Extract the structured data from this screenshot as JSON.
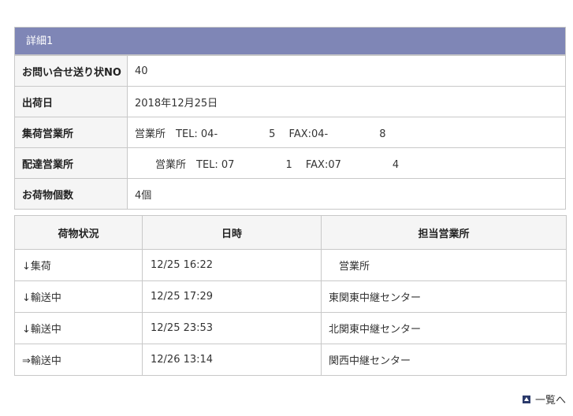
{
  "detail": {
    "header": "詳細1",
    "rows": [
      {
        "label": "お問い合せ送り状NO",
        "value": "40"
      },
      {
        "label": "出荷日",
        "value": "2018年12月25日"
      },
      {
        "label": "集荷営業所",
        "value": "営業所　TEL: 04-　　　　　5　 FAX:04-　　　　　8"
      },
      {
        "label": "配達営業所",
        "value": "　　営業所　TEL: 07　　　　　1　 FAX:07　　　　　4"
      },
      {
        "label": "お荷物個数",
        "value": "4個"
      }
    ]
  },
  "status": {
    "headers": [
      "荷物状況",
      "日時",
      "担当営業所"
    ],
    "rows": [
      {
        "state": "↓集荷",
        "datetime": "12/25 16:22",
        "office": "営業所"
      },
      {
        "state": "↓輸送中",
        "datetime": "12/25 17:29",
        "office": "東関東中継センター"
      },
      {
        "state": "↓輸送中",
        "datetime": "12/25 23:53",
        "office": "北関東中継センター"
      },
      {
        "state": "⇒輸送中",
        "datetime": "12/26 13:14",
        "office": "関西中継センター"
      }
    ]
  },
  "footer": {
    "back_label": "一覧へ",
    "icon": "up-arrow-square-icon"
  }
}
